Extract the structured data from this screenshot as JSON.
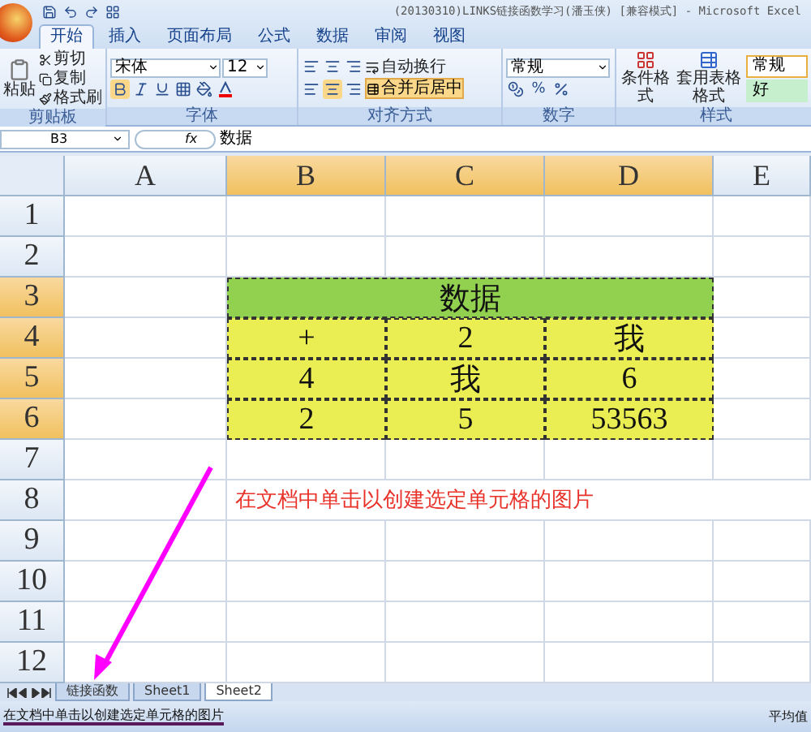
{
  "window": {
    "title": "(20130310)LINKS链接函数学习(潘玉侠)  [兼容模式] - Microsoft Excel"
  },
  "ribbon_tabs": [
    {
      "label": "开始",
      "selected": true
    },
    {
      "label": "插入",
      "selected": false
    },
    {
      "label": "页面布局",
      "selected": false
    },
    {
      "label": "公式",
      "selected": false
    },
    {
      "label": "数据",
      "selected": false
    },
    {
      "label": "审阅",
      "selected": false
    },
    {
      "label": "视图",
      "selected": false
    }
  ],
  "ribbon": {
    "clipboard": {
      "paste": "粘贴",
      "cut": "剪切",
      "copy": "复制",
      "painter": "格式刷",
      "label": "剪贴板"
    },
    "font": {
      "name": "宋体",
      "size": "12",
      "label": "字体"
    },
    "alignment": {
      "wrap": "自动换行",
      "merge": "合并后居中",
      "label": "对齐方式"
    },
    "number": {
      "format": "常规",
      "percent": "%",
      "label": "数字"
    },
    "styles": {
      "conditional": "条件格式",
      "table_format": "套用表格格式",
      "normal": "常规",
      "good": "好",
      "label": "样式"
    }
  },
  "formula_bar": {
    "name_box": "B3",
    "fx": "fx",
    "value": "数据"
  },
  "columns": [
    {
      "label": "A",
      "selected": false
    },
    {
      "label": "B",
      "selected": true
    },
    {
      "label": "C",
      "selected": true
    },
    {
      "label": "D",
      "selected": true
    },
    {
      "label": "E",
      "selected": false
    }
  ],
  "rows": [
    {
      "label": "1",
      "selected": false
    },
    {
      "label": "2",
      "selected": false
    },
    {
      "label": "3",
      "selected": true
    },
    {
      "label": "4",
      "selected": true
    },
    {
      "label": "5",
      "selected": true
    },
    {
      "label": "6",
      "selected": true
    },
    {
      "label": "7",
      "selected": false
    },
    {
      "label": "8",
      "selected": false
    },
    {
      "label": "9",
      "selected": false
    },
    {
      "label": "10",
      "selected": false
    },
    {
      "label": "11",
      "selected": false
    },
    {
      "label": "12",
      "selected": false
    }
  ],
  "table": {
    "header": "数据",
    "rows": [
      [
        "+",
        "2",
        "我"
      ],
      [
        "4",
        "我",
        "6"
      ],
      [
        "2",
        "5",
        "53563"
      ]
    ]
  },
  "annotation": "在文档中单击以创建选定单元格的图片",
  "sheet_tabs": [
    {
      "label": "链接函数",
      "selected": false
    },
    {
      "label": "Sheet1",
      "selected": false
    },
    {
      "label": "Sheet2",
      "selected": true
    }
  ],
  "status_bar": {
    "message": "在文档中单击以创建选定单元格的图片",
    "right": "平均值"
  }
}
